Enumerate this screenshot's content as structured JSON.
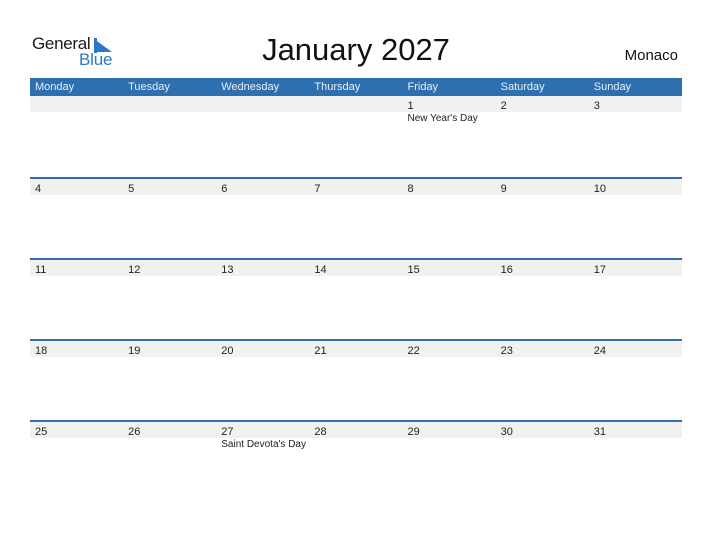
{
  "logo": {
    "general": "General",
    "blue": "Blue"
  },
  "header": {
    "title": "January 2027",
    "country": "Monaco"
  },
  "colors": {
    "accent": "#2E6FB0",
    "strip": "#F1F1F1",
    "logo_blue": "#2C78C4"
  },
  "weekdays": [
    "Monday",
    "Tuesday",
    "Wednesday",
    "Thursday",
    "Friday",
    "Saturday",
    "Sunday"
  ],
  "weeks": [
    {
      "days": [
        "",
        "",
        "",
        "",
        "1",
        "2",
        "3"
      ],
      "holidays": [
        "",
        "",
        "",
        "",
        "New Year's Day",
        "",
        ""
      ]
    },
    {
      "days": [
        "4",
        "5",
        "6",
        "7",
        "8",
        "9",
        "10"
      ],
      "holidays": [
        "",
        "",
        "",
        "",
        "",
        "",
        ""
      ]
    },
    {
      "days": [
        "11",
        "12",
        "13",
        "14",
        "15",
        "16",
        "17"
      ],
      "holidays": [
        "",
        "",
        "",
        "",
        "",
        "",
        ""
      ]
    },
    {
      "days": [
        "18",
        "19",
        "20",
        "21",
        "22",
        "23",
        "24"
      ],
      "holidays": [
        "",
        "",
        "",
        "",
        "",
        "",
        ""
      ]
    },
    {
      "days": [
        "25",
        "26",
        "27",
        "28",
        "29",
        "30",
        "31"
      ],
      "holidays": [
        "",
        "",
        "Saint Devota's Day",
        "",
        "",
        "",
        ""
      ]
    }
  ]
}
